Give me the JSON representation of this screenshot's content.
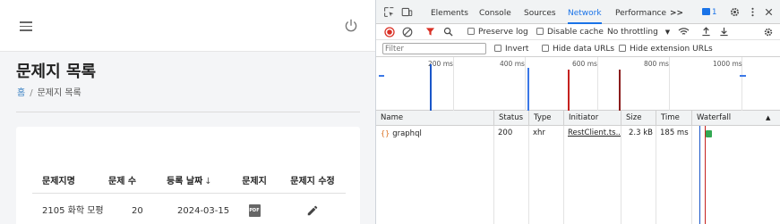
{
  "app": {
    "page_title": "문제지 목록",
    "breadcrumb": {
      "home": "홈",
      "separator": "/",
      "current": "문제지 목록"
    },
    "table": {
      "headers": {
        "name": "문제지명",
        "count": "문제 수",
        "date": "등록 날짜",
        "sort_arrow": "↓",
        "file": "문제지",
        "edit": "문제지 수정"
      },
      "rows": [
        {
          "name": "2105 화학 모평",
          "count": "20",
          "date": "2024-03-15",
          "file_icon": "pdf-icon",
          "edit_icon": "pencil-icon"
        }
      ]
    }
  },
  "devtools": {
    "tabs": [
      "Elements",
      "Console",
      "Sources",
      "Network",
      "Performance"
    ],
    "active_tab": "Network",
    "more_tabs": ">>",
    "issues_count": "1",
    "toolbar": {
      "preserve_log": "Preserve log",
      "disable_cache": "Disable cache",
      "throttling": "No throttling",
      "throttling_arrow": "▼"
    },
    "filter": {
      "placeholder": "Filter",
      "invert": "Invert",
      "hide_data_urls": "Hide data URLs",
      "hide_extension_urls": "Hide extension URLs"
    },
    "overview_ticks": [
      "200 ms",
      "400 ms",
      "600 ms",
      "800 ms",
      "1000 ms"
    ],
    "columns": {
      "name": "Name",
      "status": "Status",
      "type": "Type",
      "initiator": "Initiator",
      "size": "Size",
      "time": "Time",
      "waterfall": "Waterfall",
      "sort": "▲"
    },
    "requests": [
      {
        "name": "graphql",
        "status": "200",
        "type": "xhr",
        "initiator": "RestClient.ts...",
        "size": "2.3 kB",
        "time": "185 ms"
      }
    ],
    "colors": {
      "accent": "#1a73e8",
      "record": "#d93025",
      "filter_funnel": "#d93025",
      "dom_content_loaded": "#1a56c9",
      "load_event": "#c5221f"
    }
  }
}
